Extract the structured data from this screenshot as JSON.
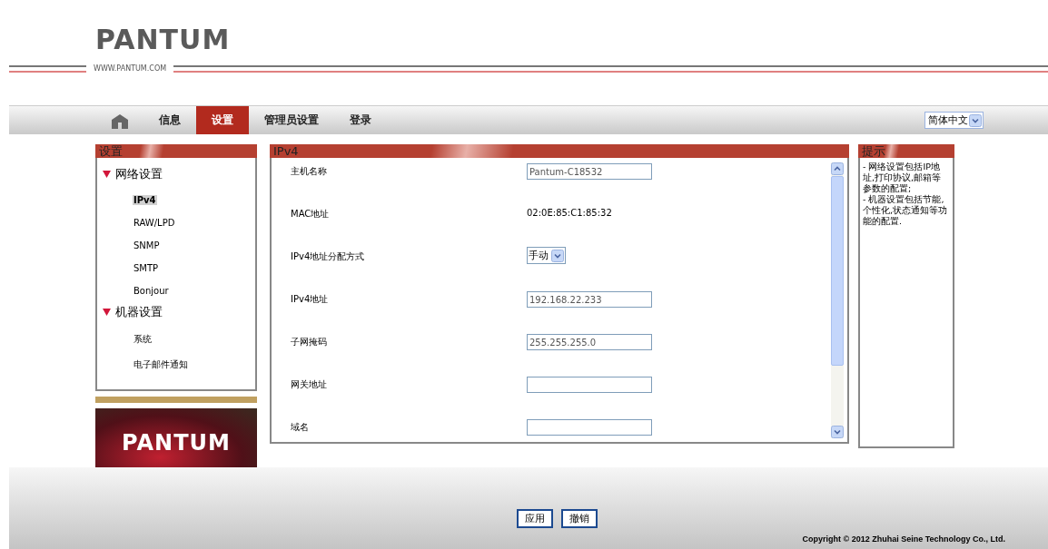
{
  "header": {
    "logo": "PANTUM",
    "website": "WWW.PANTUM.COM"
  },
  "nav": {
    "tabs": [
      {
        "label": "信息",
        "selected": false
      },
      {
        "label": "设置",
        "selected": true
      },
      {
        "label": "管理员设置",
        "selected": false
      },
      {
        "label": "登录",
        "selected": false
      }
    ],
    "language": "简体中文"
  },
  "sidebar": {
    "title": "设置",
    "groups": [
      {
        "label": "网络设置",
        "expanded": true,
        "children": [
          {
            "label": "IPv4",
            "selected": true
          },
          {
            "label": "RAW/LPD",
            "selected": false
          },
          {
            "label": "SNMP",
            "selected": false
          },
          {
            "label": "SMTP",
            "selected": false
          },
          {
            "label": "Bonjour",
            "selected": false
          }
        ]
      },
      {
        "label": "机器设置",
        "expanded": true,
        "children": [
          {
            "label": "系统",
            "selected": false
          },
          {
            "label": "电子邮件通知",
            "selected": false
          }
        ]
      }
    ],
    "banner_logo": "PANTUM"
  },
  "form": {
    "title": "IPv4",
    "fields": [
      {
        "label": "主机名称",
        "kind": "input",
        "value": "Pantum-C18532"
      },
      {
        "label": "MAC地址",
        "kind": "text",
        "value": "02:0E:85:C1:85:32"
      },
      {
        "label": "IPv4地址分配方式",
        "kind": "select",
        "value": "手动"
      },
      {
        "label": "IPv4地址",
        "kind": "input",
        "value": "192.168.22.233"
      },
      {
        "label": "子网掩码",
        "kind": "input",
        "value": "255.255.255.0"
      },
      {
        "label": "网关地址",
        "kind": "input"
      },
      {
        "label": "域名",
        "kind": "input"
      }
    ]
  },
  "hint": {
    "title": "提示",
    "lines": [
      "- 网络设置包括IP地址,打印协议,邮箱等参数的配置;",
      "- 机器设置包括节能,个性化,状态通知等功能的配置."
    ]
  },
  "buttons": [
    "应用",
    "撤销"
  ],
  "copyright": "Copyright © 2012 Zhuhai Seine Technology Co., Ltd."
}
